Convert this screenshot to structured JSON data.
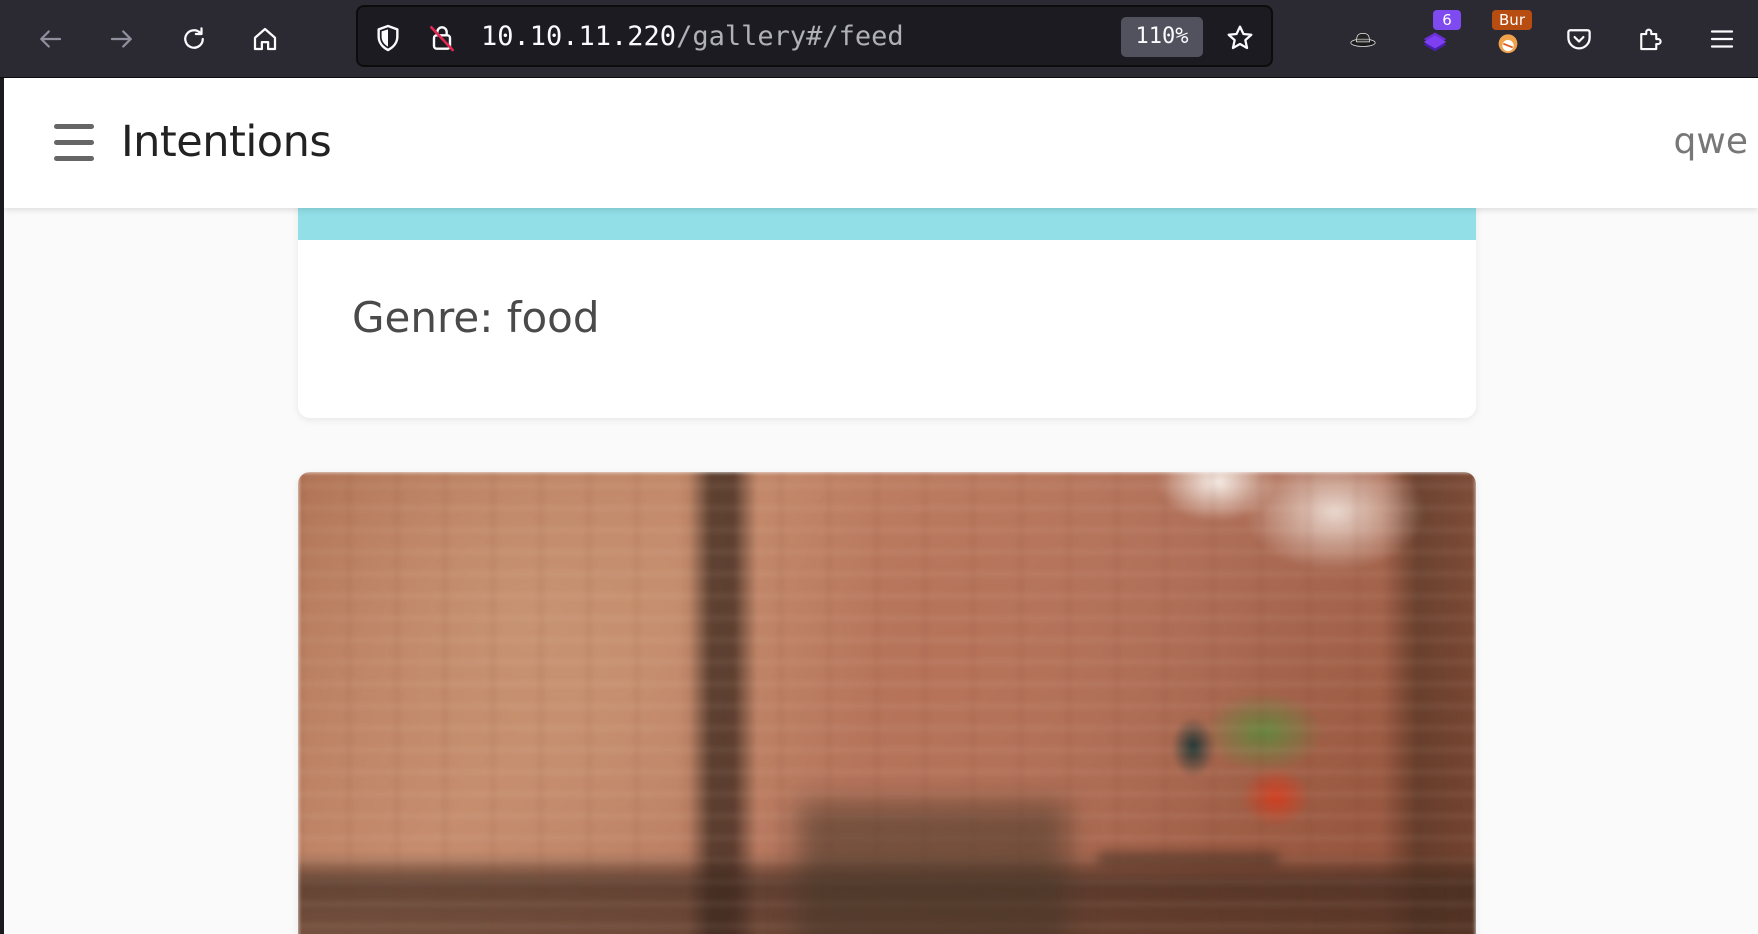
{
  "browser": {
    "url_host": "10.10.11.220",
    "url_path": "/gallery#/feed",
    "zoom": "110%",
    "extensions": [
      {
        "name": "hat-extension"
      },
      {
        "name": "stack-extension",
        "badge": "6"
      },
      {
        "name": "burp-extension",
        "badge": "Bur"
      }
    ]
  },
  "app": {
    "title": "Intentions",
    "username": "qwe"
  },
  "feed": {
    "cards": [
      {
        "genre_label": "Genre: food"
      }
    ]
  },
  "colors": {
    "toolbar_bg": "#2b2a33",
    "urlbar_bg": "#1c1b22",
    "page_bg": "#fafafa",
    "card_image_strip": "#92dfe8"
  }
}
